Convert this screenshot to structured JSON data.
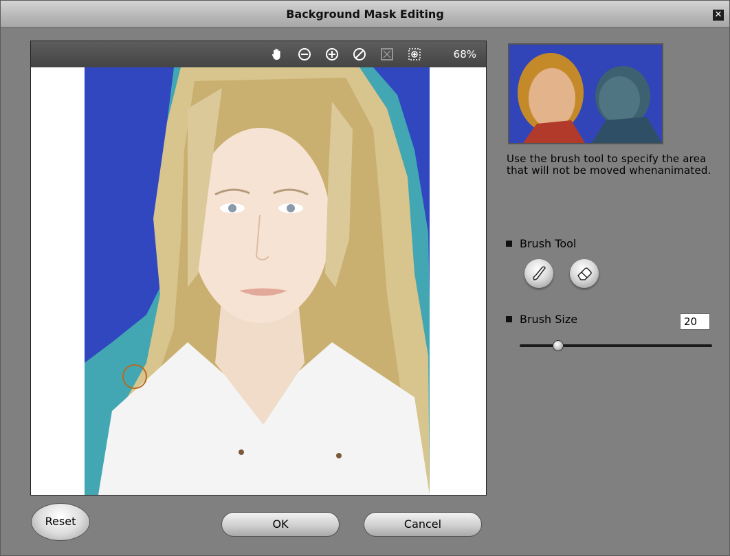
{
  "window": {
    "title": "Background Mask Editing",
    "close_glyph": "✕"
  },
  "canvas": {
    "zoom": "68%",
    "tools": [
      "hand-icon",
      "zoom-out-icon",
      "zoom-in-icon",
      "clear-icon",
      "fit-icon",
      "actual-size-icon"
    ]
  },
  "panel": {
    "help_text": "Use the brush tool to specify the area that will not be moved whenanimated.",
    "brush_tool_label": "Brush Tool",
    "brush_size_label": "Brush Size",
    "brush_size_value": "20",
    "brush_size_fraction": 0.2
  },
  "buttons": {
    "reset": "Reset",
    "ok": "OK",
    "cancel": "Cancel"
  },
  "colors": {
    "mask_blue": "#3047c0",
    "mask_teal": "#43a7b3"
  }
}
